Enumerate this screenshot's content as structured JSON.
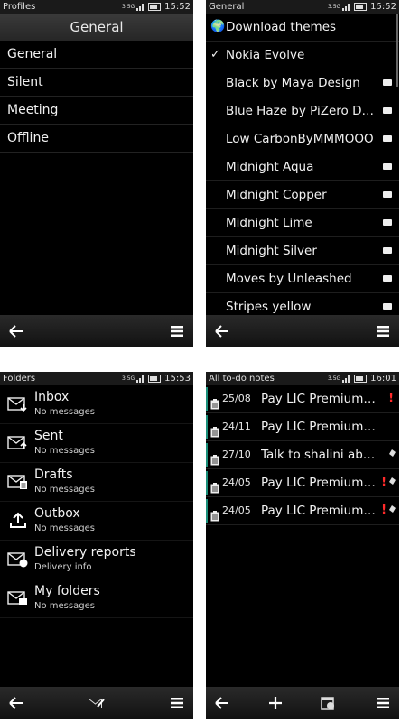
{
  "profiles": {
    "status_title": "Profiles",
    "network": "3.5G",
    "time": "15:52",
    "header": "General",
    "items": [
      "General",
      "Silent",
      "Meeting",
      "Offline"
    ]
  },
  "themes": {
    "status_title": "General",
    "network": "3.5G",
    "time": "15:52",
    "download_label": "Download themes",
    "selected_label": "Nokia Evolve",
    "items": [
      "Black by Maya Design",
      "Blue Haze by PiZero Design",
      "Low CarbonByMMMOOO",
      "Midnight Aqua",
      "Midnight Copper",
      "Midnight Lime",
      "Midnight Silver",
      "Moves by Unleashed",
      "Stripes yellow"
    ]
  },
  "folders": {
    "status_title": "Folders",
    "network": "3.5G",
    "time": "15:53",
    "items": [
      {
        "name": "Inbox",
        "sub": "No messages",
        "icon": "inbox-icon"
      },
      {
        "name": "Sent",
        "sub": "No messages",
        "icon": "sent-icon"
      },
      {
        "name": "Drafts",
        "sub": "No messages",
        "icon": "drafts-icon"
      },
      {
        "name": "Outbox",
        "sub": "No messages",
        "icon": "outbox-icon"
      },
      {
        "name": "Delivery reports",
        "sub": "Delivery info",
        "icon": "delivery-reports-icon"
      },
      {
        "name": "My folders",
        "sub": "No messages",
        "icon": "my-folders-icon"
      }
    ]
  },
  "todos": {
    "status_title": "All to-do notes",
    "network": "3.5G",
    "time": "16:01",
    "items": [
      {
        "date": "25/08",
        "text": "Pay LIC Premium monthly",
        "priority": "!",
        "reminder": false
      },
      {
        "date": "24/11",
        "text": "Pay LIC Premium of policy",
        "priority": "",
        "reminder": false
      },
      {
        "date": "27/10",
        "text": "Talk to shalini about it",
        "priority": "",
        "reminder": true
      },
      {
        "date": "24/05",
        "text": "Pay LIC Premium due",
        "priority": "!",
        "reminder": true
      },
      {
        "date": "24/05",
        "text": "Pay LIC Premium due",
        "priority": "!",
        "reminder": true
      }
    ]
  },
  "colors": {
    "accent": "#1a8f7a",
    "priority": "#ff2a2a"
  }
}
